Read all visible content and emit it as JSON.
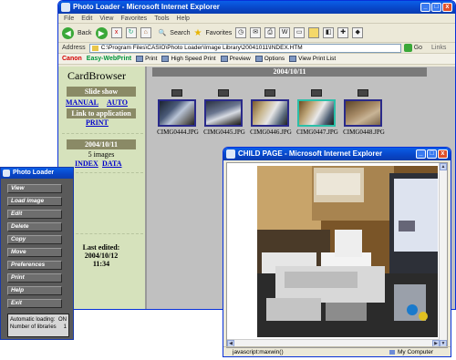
{
  "ie_main": {
    "title": "Photo Loader - Microsoft Internet Explorer",
    "menu": [
      "File",
      "Edit",
      "View",
      "Favorites",
      "Tools",
      "Help"
    ],
    "toolbar": {
      "back": "Back",
      "search": "Search",
      "favorites": "Favorites"
    },
    "address_label": "Address",
    "address_value": "C:\\Program Files\\CASIO\\Photo Loader\\Image Library\\20041011\\INDEX.HTM",
    "go_label": "Go",
    "links_label": "Links",
    "canon_bar": {
      "brand": "Canon",
      "product": "Easy-WebPrint",
      "print": "Print",
      "high_speed": "High Speed Print",
      "preview": "Preview",
      "options": "Options",
      "view_list": "View Print List"
    }
  },
  "left_frame": {
    "title": "CardBrowser",
    "slide_show": "Slide show",
    "manual": "MANUAL",
    "auto": "AUTO",
    "link_app": "Link to application",
    "print": "PRINT",
    "date": "2004/10/11",
    "images_count": "5 images",
    "index": "INDEX",
    "data": "DATA",
    "last_edited_label": "Last edited:",
    "last_edited_date": "2004/10/12",
    "last_edited_time": "11:34"
  },
  "main_frame": {
    "date": "2004/10/11",
    "thumbnails": [
      {
        "name": "CIMG0444.JPG"
      },
      {
        "name": "CIMG0445.JPG"
      },
      {
        "name": "CIMG0446.JPG"
      },
      {
        "name": "CIMG0447.JPG"
      },
      {
        "name": "CIMG0448.JPG"
      }
    ]
  },
  "photo_loader": {
    "title": "Photo Loader",
    "buttons": [
      "View",
      "Load image",
      "Edit",
      "Delete",
      "Copy",
      "Move",
      "Preferences",
      "Print",
      "Help",
      "Exit"
    ],
    "status": {
      "auto_loading_label": "Automatic loading:",
      "auto_loading_value": "ON",
      "libraries_label": "Number of libraries",
      "libraries_value": "1"
    }
  },
  "child_window": {
    "title": "CHILD PAGE - Microsoft Internet Explorer",
    "status_text": "javascript:maxwin()",
    "zone": "My Computer"
  }
}
